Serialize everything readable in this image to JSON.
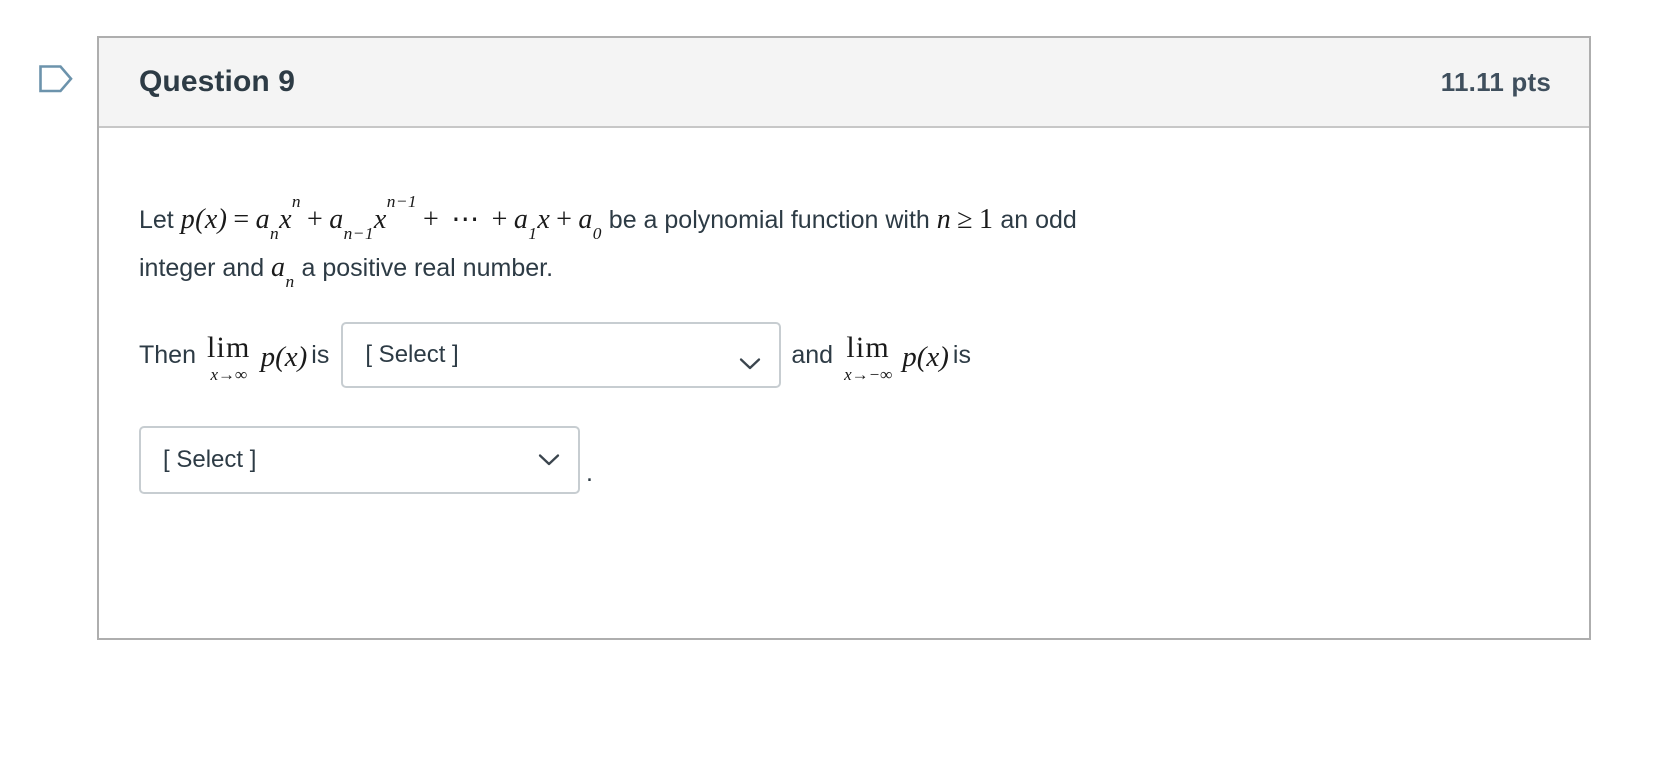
{
  "flag": {
    "icon": "flag-outline-icon",
    "color": "#5f8ba6"
  },
  "header": {
    "title": "Question 9",
    "points": "11.11 pts"
  },
  "body": {
    "line1": {
      "lead": "Let ",
      "math_px": "p(x)",
      "equals": "=",
      "term_a_n": "a",
      "sub_n": "n",
      "x_sym": "x",
      "sup_n": "n",
      "plus": "+",
      "term_a_n_minus_1": "a",
      "sub_n_minus_1": "n−1",
      "sup_n_minus_1": "n−1",
      "dots": "⋯",
      "term_a_1": "a",
      "sub_1": "1",
      "term_a_0": "a",
      "sub_0": "0",
      "tail_1": " be a polynomial function with ",
      "n_sym": "n",
      "ge": "≥",
      "one": "1",
      "tail_2": " an odd"
    },
    "line2": {
      "lead": "integer and ",
      "a_sym": "a",
      "sub_n": "n",
      "tail": " a positive real number."
    },
    "line3": {
      "then": "Then",
      "lim_op": "lim",
      "lim_sub": "x→∞",
      "px": "p(x)",
      "is": "is",
      "and": "and",
      "lim_op_2": "lim",
      "lim_sub_2": "x→−∞",
      "px_2": "p(x)",
      "is_2": "is"
    },
    "select_1": {
      "value": "[ Select ]",
      "chevron": "chevron-down-icon"
    },
    "select_2": {
      "value": "[ Select ]",
      "chevron": "chevron-down-icon"
    },
    "period": "."
  },
  "colors": {
    "text": "#2d3b45",
    "header_bg": "#f4f4f4",
    "card_border": "#aeaeae",
    "select_border": "#c7cdd1",
    "flag": "#5f8ba6"
  }
}
